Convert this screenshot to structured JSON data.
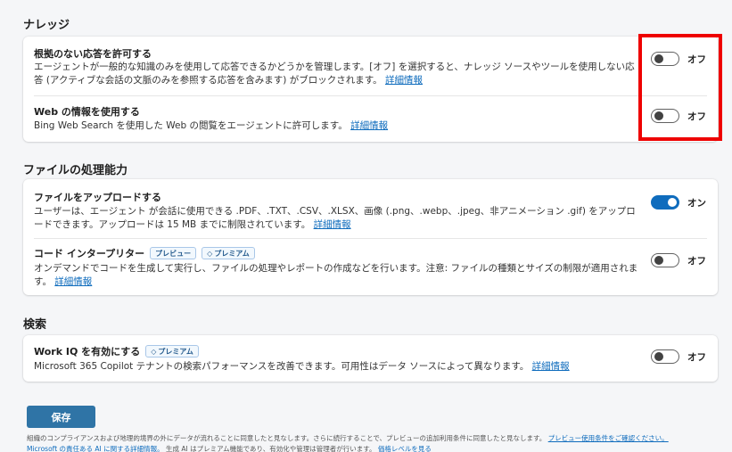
{
  "sections": {
    "knowledge": {
      "title": "ナレッジ",
      "rows": [
        {
          "title": "根拠のない応答を許可する",
          "description": "エージェントが一般的な知識のみを使用して応答できるかどうかを管理します。[オフ] を選択すると、ナレッジ ソースやツールを使用しない応答 (アクティブな会話の文脈のみを参照する応答を含みます) がブロックされます。",
          "link": "詳細情報",
          "toggle_state": "off",
          "toggle_label": "オフ"
        },
        {
          "title": "Web の情報を使用する",
          "description": "Bing Web Search を使用した Web の閲覧をエージェントに許可します。",
          "link": "詳細情報",
          "toggle_state": "off",
          "toggle_label": "オフ"
        }
      ]
    },
    "file_processing": {
      "title": "ファイルの処理能力",
      "rows": [
        {
          "title": "ファイルをアップロードする",
          "description": "ユーザーは、エージェント が会話に使用できる .PDF、.TXT、.CSV、.XLSX、画像 (.png、.webp、.jpeg、非アニメーション .gif) をアップロードできます。アップロードは 15 MB までに制限されています。",
          "link": "詳細情報",
          "toggle_state": "on",
          "toggle_label": "オン"
        },
        {
          "title": "コード インタープリター",
          "badges": [
            "プレビュー",
            "プレミアム"
          ],
          "description": "オンデマンドでコードを生成して実行し、ファイルの処理やレポートの作成などを行います。注意: ファイルの種類とサイズの制限が適用されます。",
          "link": "詳細情報",
          "toggle_state": "off",
          "toggle_label": "オフ"
        }
      ]
    },
    "search": {
      "title": "検索",
      "rows": [
        {
          "title": "Work IQ を有効にする",
          "badges": [
            "プレミアム"
          ],
          "description": "Microsoft 365 Copilot テナントの検索パフォーマンスを改善できます。可用性はデータ ソースによって異なります。",
          "link": "詳細情報",
          "toggle_state": "off",
          "toggle_label": "オフ"
        }
      ]
    }
  },
  "save_label": "保存",
  "footer": {
    "line1": "組織のコンプライアンスおよび地理的境界の外にデータが流れることに同意したと見なします。さらに続行することで、プレビューの追加利用条件に同意したと見なします。",
    "line1_link": "プレビュー使用条件をご確認ください。",
    "line2_link1": "Microsoft の責任ある AI に関する詳細情報。",
    "line2_text": "生成 AI はプレミアム機能であり、有効化や管理は管理者が行います。",
    "line2_link2": "価格レベルを見る"
  },
  "colors": {
    "accent": "#0f6cbd",
    "save_button": "#2f74a6",
    "highlight": "#ee0000",
    "badge_text": "#245a8d"
  }
}
